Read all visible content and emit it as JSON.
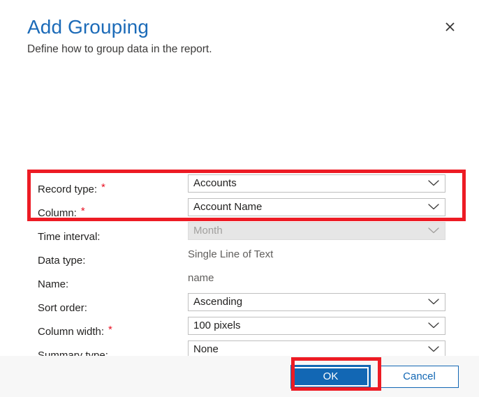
{
  "dialog": {
    "title": "Add Grouping",
    "subtitle": "Define how to group data in the report.",
    "close_label": "Close",
    "close_icon": "close-icon"
  },
  "colors": {
    "title_blue": "#1c6bb8",
    "accent_blue": "#1267b4",
    "required_red": "#e81123",
    "highlight_red": "#ed1b24",
    "footer_bg": "#f7f7f7",
    "disabled_bg": "#e6e6e6",
    "disabled_text": "#a19f9d",
    "readonly_text": "#605e5c",
    "label_text": "#201f1e",
    "field_border": "#bfbfbf"
  },
  "form": {
    "fields": [
      {
        "name": "record-type",
        "label": "Record type:",
        "required": true,
        "control": "combobox",
        "value": "Accounts",
        "disabled": false
      },
      {
        "name": "column",
        "label": "Column:",
        "required": true,
        "control": "combobox",
        "value": "Account Name",
        "disabled": false
      },
      {
        "name": "time-interval",
        "label": "Time interval:",
        "required": false,
        "control": "combobox",
        "value": "Month",
        "disabled": true
      },
      {
        "name": "data-type",
        "label": "Data type:",
        "required": false,
        "control": "static",
        "value": "Single Line of Text",
        "disabled": false
      },
      {
        "name": "field-name",
        "label": "Name:",
        "required": false,
        "control": "static",
        "value": "name",
        "disabled": false
      },
      {
        "name": "sort-order",
        "label": "Sort order:",
        "required": false,
        "control": "combobox",
        "value": "Ascending",
        "disabled": false
      },
      {
        "name": "column-width",
        "label": "Column width:",
        "required": true,
        "control": "combobox",
        "value": "100 pixels",
        "disabled": false
      },
      {
        "name": "summary-type",
        "label": "Summary type:",
        "required": false,
        "control": "combobox",
        "value": "None",
        "disabled": false
      }
    ],
    "required_marker": "*",
    "chevron_icon": "chevron-down-icon"
  },
  "footer": {
    "ok_label": "OK",
    "cancel_label": "Cancel"
  },
  "annotations": [
    {
      "name": "highlight-required-fields",
      "target": "record-type,column"
    },
    {
      "name": "highlight-ok-button",
      "target": "ok-button"
    }
  ]
}
